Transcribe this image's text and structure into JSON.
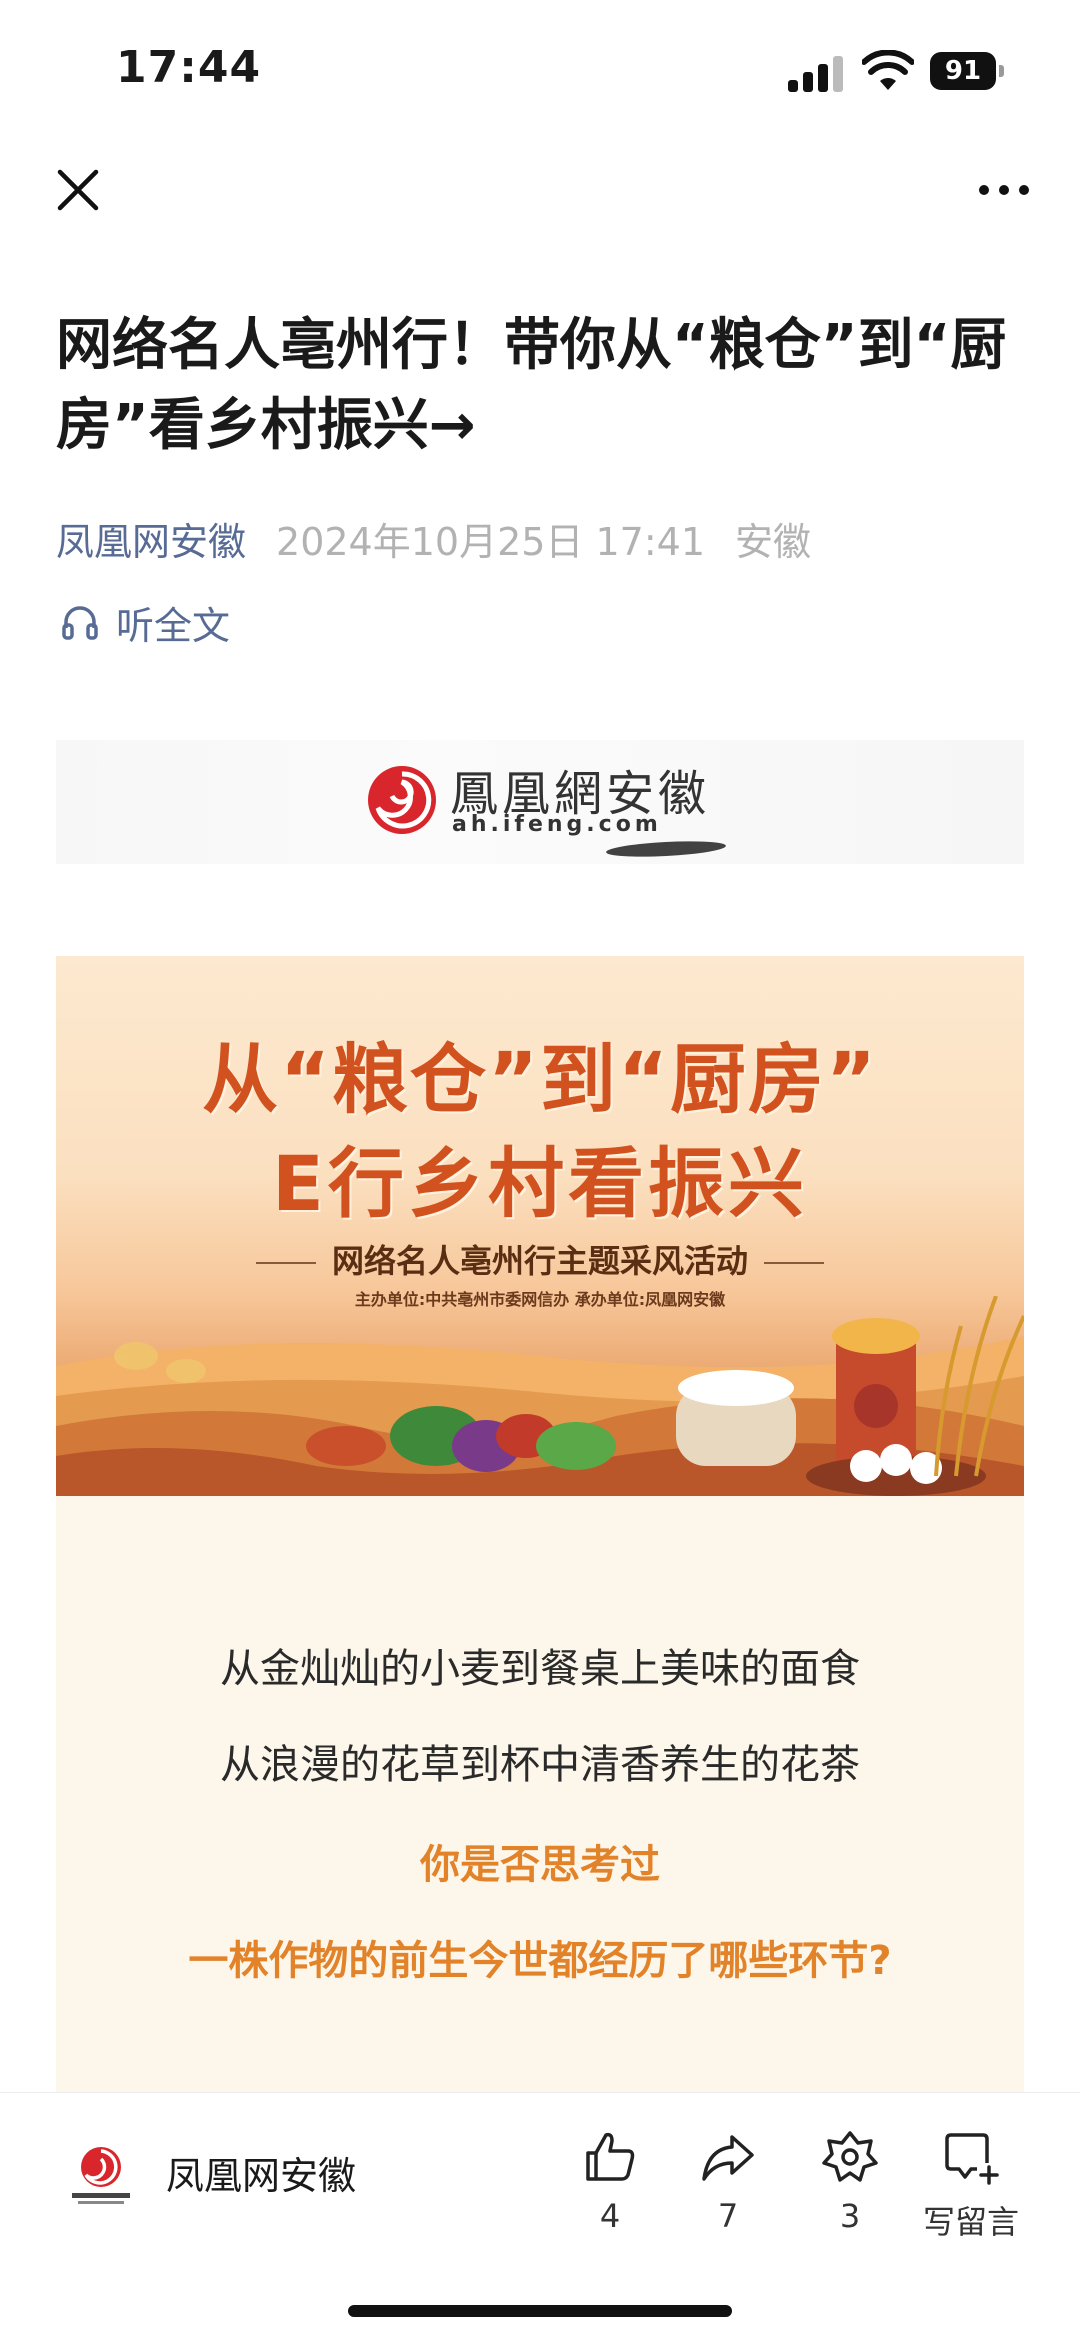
{
  "status_bar": {
    "time": "17:44",
    "battery": "91",
    "icons": [
      "signal-icon",
      "wifi-icon",
      "battery-icon"
    ]
  },
  "nav": {
    "icons": [
      "close-icon",
      "more-icon"
    ]
  },
  "article": {
    "title": "网络名人亳州行！带你从“粮仓”到“厨房”看乡村振兴→",
    "source": "凤凰网安徽",
    "date": "2024年10月25日 17:41",
    "region": "安徽",
    "listen_label": "听全文"
  },
  "logo_banner": {
    "name_cn": "鳳凰網安徽",
    "url": "ah.ifeng.com"
  },
  "poster": {
    "title_line1": "从“粮仓”到“厨房”",
    "title_line2": "E行乡村看振兴",
    "subtitle": "网络名人亳州行主题采风活动",
    "organizers": "主办单位:中共亳州市委网信办    承办单位:凤凰网安徽"
  },
  "intro": {
    "line1": "从金灿灿的小麦到餐桌上美味的面食",
    "line2": "从浪漫的花草到杯中清香养生的花茶",
    "line3": "你是否思考过",
    "line4": "一株作物的前生今世都经历了哪些环节?"
  },
  "bottom_bar": {
    "account_name": "凤凰网安徽",
    "like_count": "4",
    "share_count": "7",
    "recommend_count": "3",
    "comment_label": "写留言"
  },
  "colors": {
    "link_blue": "#576b95",
    "meta_gray": "#b2b2b2",
    "poster_title": "#d2521f",
    "intro_accent": "#e2832a",
    "brand_red": "#d8262c"
  }
}
